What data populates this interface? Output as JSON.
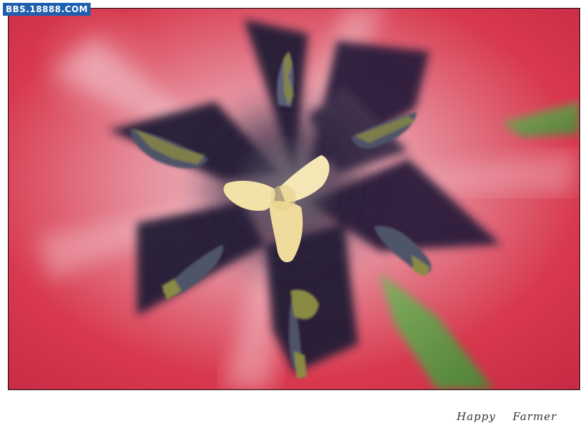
{
  "watermark": {
    "text": "BBS.18888.COM",
    "color": "#1d5fb0"
  },
  "photo": {
    "subject": "tulip-center-macro",
    "colors": {
      "petal": "#d8394f",
      "petal_light": "#e8a0aa",
      "center_dark": "#241a35",
      "pistil": "#f3e2a8",
      "anther": "#8b8a45",
      "leaf": "#5fa04a"
    }
  },
  "signature": {
    "text": "Happy Farmer"
  }
}
